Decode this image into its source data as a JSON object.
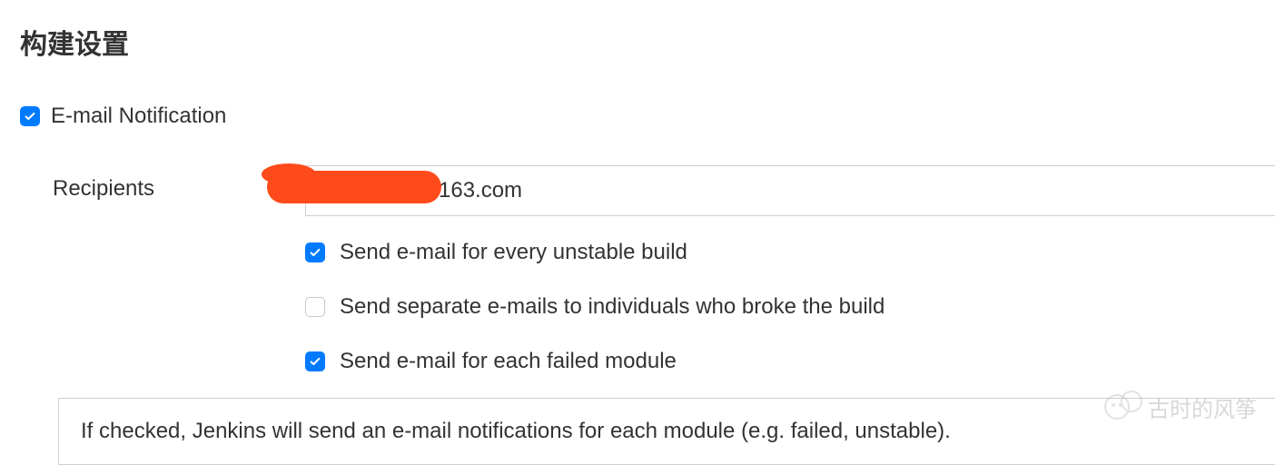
{
  "page": {
    "title": "构建设置"
  },
  "emailNotification": {
    "label": "E-mail Notification",
    "checked": true,
    "recipients": {
      "label": "Recipients",
      "value": "163.com"
    },
    "options": [
      {
        "label": "Send e-mail for every unstable build",
        "checked": true
      },
      {
        "label": "Send separate e-mails to individuals who broke the build",
        "checked": false
      },
      {
        "label": "Send e-mail for each failed module",
        "checked": true
      }
    ],
    "helpText": "If checked, Jenkins will send an e-mail notifications for each module (e.g. failed, unstable)."
  },
  "watermark": {
    "text": "古时的风筝"
  }
}
